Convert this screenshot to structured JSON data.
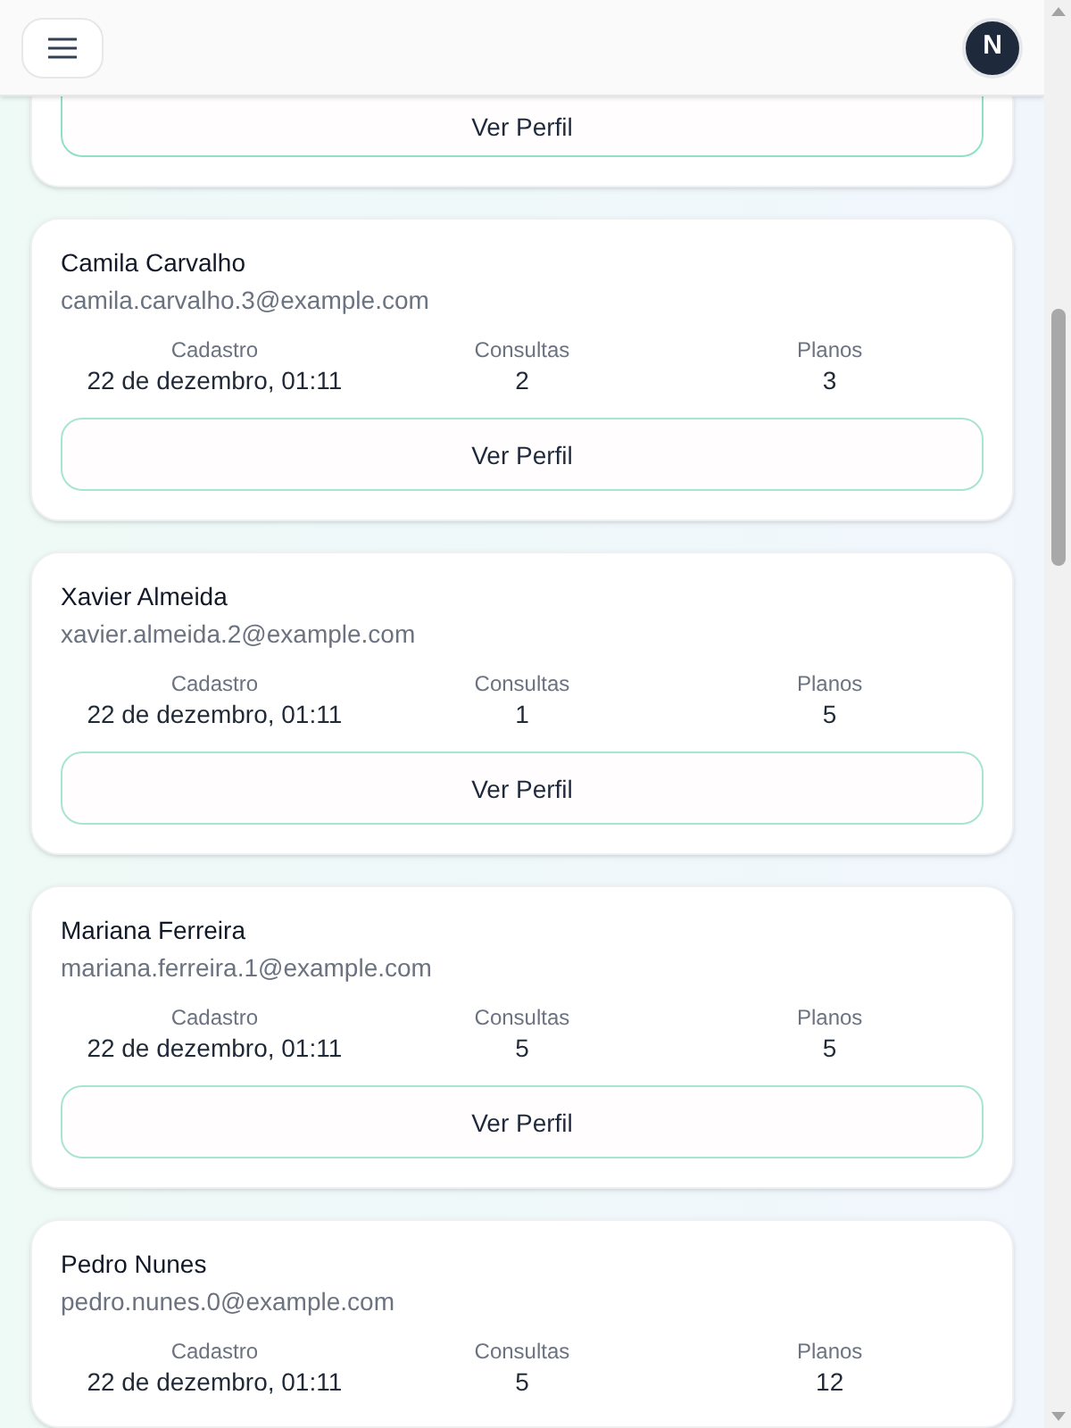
{
  "header": {
    "avatar_initial": "N"
  },
  "partial_card": {
    "button": "Ver Perfil"
  },
  "users": [
    {
      "name": "Camila Carvalho",
      "email": "camila.carvalho.3@example.com",
      "stats": [
        {
          "label": "Cadastro",
          "value": "22 de dezembro, 01:11"
        },
        {
          "label": "Consultas",
          "value": "2"
        },
        {
          "label": "Planos",
          "value": "3"
        }
      ],
      "button": "Ver Perfil"
    },
    {
      "name": "Xavier Almeida",
      "email": "xavier.almeida.2@example.com",
      "stats": [
        {
          "label": "Cadastro",
          "value": "22 de dezembro, 01:11"
        },
        {
          "label": "Consultas",
          "value": "1"
        },
        {
          "label": "Planos",
          "value": "5"
        }
      ],
      "button": "Ver Perfil"
    },
    {
      "name": "Mariana Ferreira",
      "email": "mariana.ferreira.1@example.com",
      "stats": [
        {
          "label": "Cadastro",
          "value": "22 de dezembro, 01:11"
        },
        {
          "label": "Consultas",
          "value": "5"
        },
        {
          "label": "Planos",
          "value": "5"
        }
      ],
      "button": "Ver Perfil"
    },
    {
      "name": "Pedro Nunes",
      "email": "pedro.nunes.0@example.com",
      "stats": [
        {
          "label": "Cadastro",
          "value": "22 de dezembro, 01:11"
        },
        {
          "label": "Consultas",
          "value": "5"
        },
        {
          "label": "Planos",
          "value": "12"
        }
      ]
    }
  ]
}
